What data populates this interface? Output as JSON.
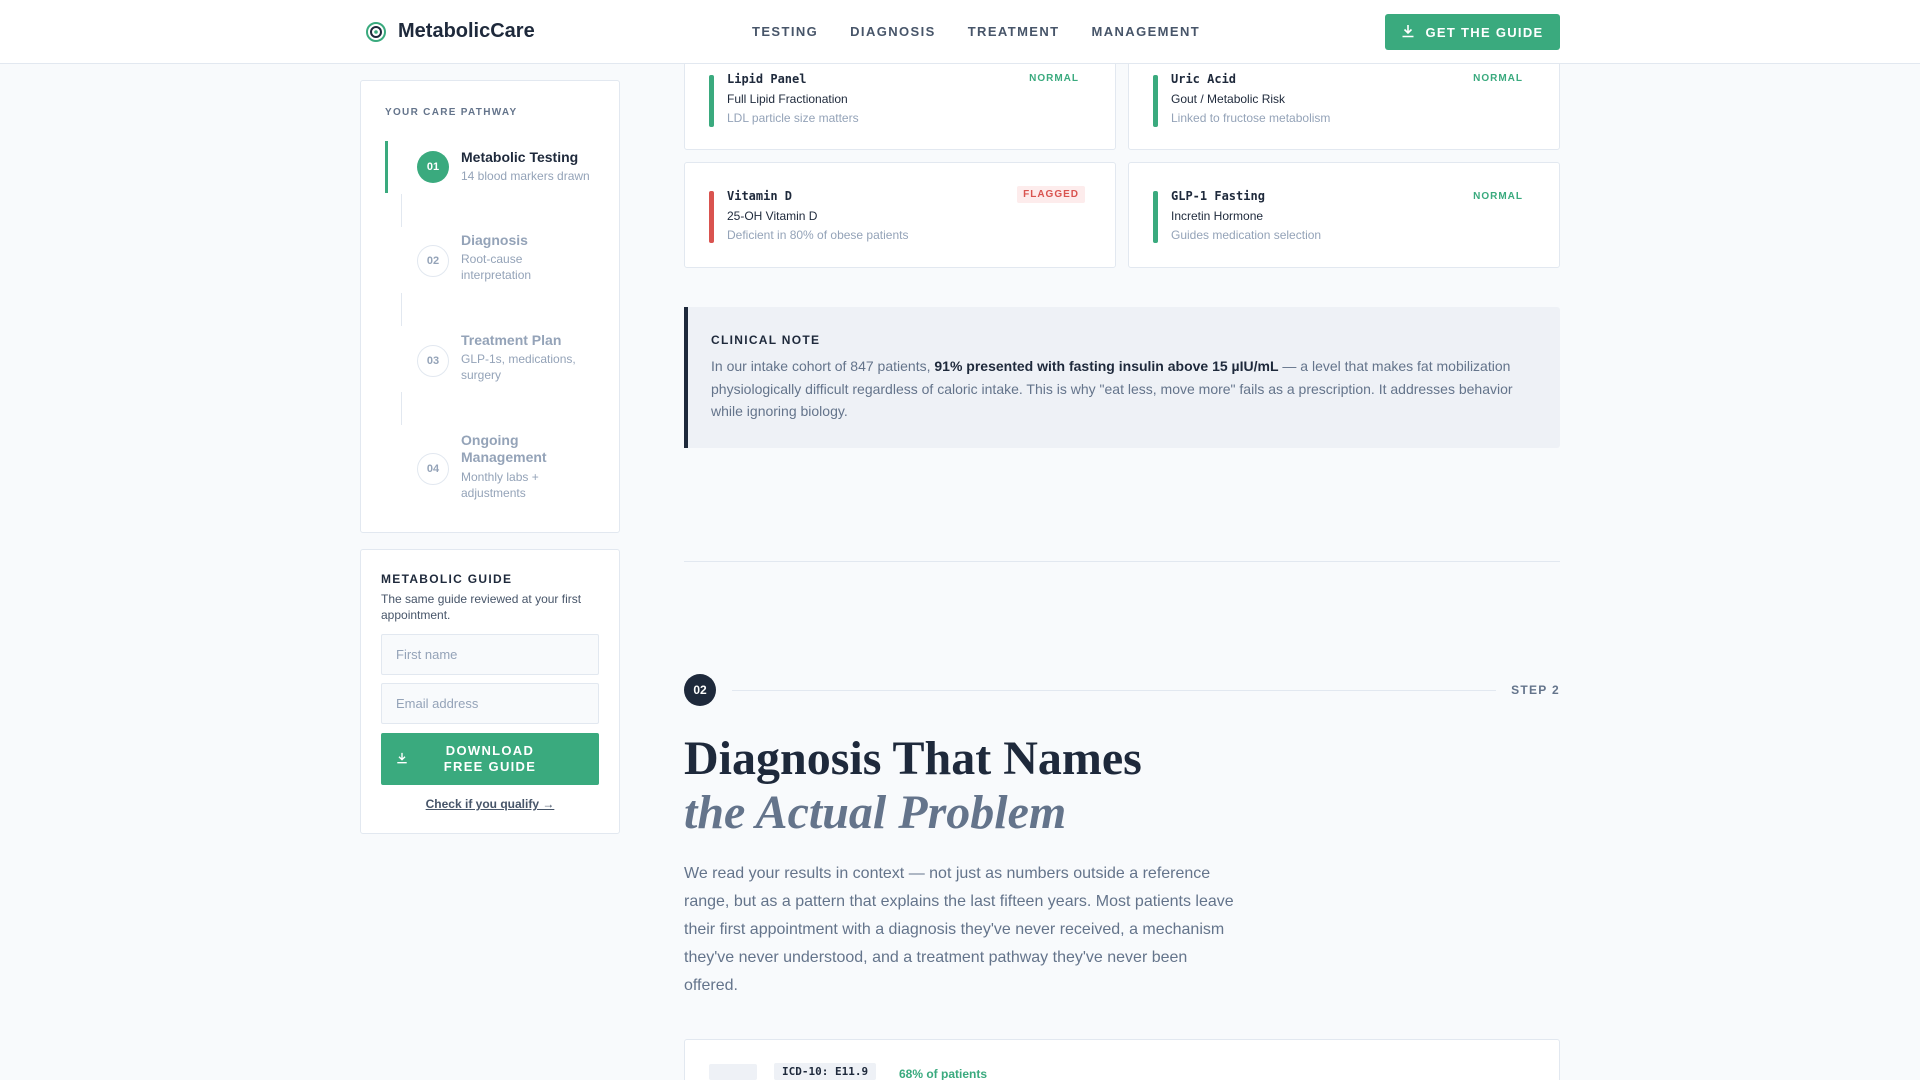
{
  "header": {
    "brand": "MetabolicCare",
    "nav": [
      "TESTING",
      "DIAGNOSIS",
      "TREATMENT",
      "MANAGEMENT"
    ],
    "cta_label": "GET THE GUIDE",
    "accent": "#3aaa7e",
    "cta_icon": "download-icon",
    "logo_icon": "swirl-logo-icon"
  },
  "pathway": {
    "title": "YOUR CARE PATHWAY",
    "steps": [
      {
        "num": "01",
        "title": "Metabolic Testing",
        "sub": "14 blood markers drawn",
        "active": true
      },
      {
        "num": "02",
        "title": "Diagnosis",
        "sub": "Root-cause interpretation",
        "active": false
      },
      {
        "num": "03",
        "title": "Treatment Plan",
        "sub": "GLP-1s, medications, surgery",
        "active": false
      },
      {
        "num": "04",
        "title": "Ongoing Management",
        "sub": "Monthly labs + adjustments",
        "active": false
      }
    ]
  },
  "guide": {
    "title": "METABOLIC GUIDE",
    "subtitle": "The same guide reviewed at your first appointment.",
    "first_name_placeholder": "First name",
    "email_placeholder": "Email address",
    "button_label": "DOWNLOAD FREE GUIDE",
    "qualify_link": "Check if you qualify →"
  },
  "labs": [
    {
      "name": "Lipid Panel",
      "desc": "Full Lipid Fractionation",
      "note": "LDL particle size matters",
      "status": "NORMAL",
      "status_color": "#3aaa7e"
    },
    {
      "name": "Uric Acid",
      "desc": "Gout / Metabolic Risk",
      "note": "Linked to fructose metabolism",
      "status": "NORMAL",
      "status_color": "#3aaa7e"
    },
    {
      "name": "Vitamin D",
      "desc": "25-OH Vitamin D",
      "note": "Deficient in 80% of obese patients",
      "status": "FLAGGED",
      "status_color": "#d9534f"
    },
    {
      "name": "GLP-1 Fasting",
      "desc": "Incretin Hormone",
      "note": "Guides medication selection",
      "status": "NORMAL",
      "status_color": "#3aaa7e"
    }
  ],
  "clinical_note": {
    "title": "CLINICAL NOTE",
    "before": "In our intake cohort of 847 patients, ",
    "highlight": "91% presented with fasting insulin above 15 µIU/mL",
    "after": " — a level that makes fat mobilization physiologically difficult regardless of caloric intake. This is why \"eat less, move more\" fails as a prescription. It addresses behavior while ignoring biology."
  },
  "step2": {
    "num": "02",
    "label": "STEP 2",
    "title_line1": "Diagnosis That Names",
    "title_line2": "the Actual Problem",
    "lead": "We read your results in context — not just as numbers outside a reference range, but as a pattern that explains the last fifteen years. Most patients leave their first appointment with a diagnosis they've never received, a mechanism they've never understood, and a treatment pathway they've never been offered.",
    "dx_code": "ICD-10: E11.9",
    "dx_pct": "68% of patients"
  }
}
